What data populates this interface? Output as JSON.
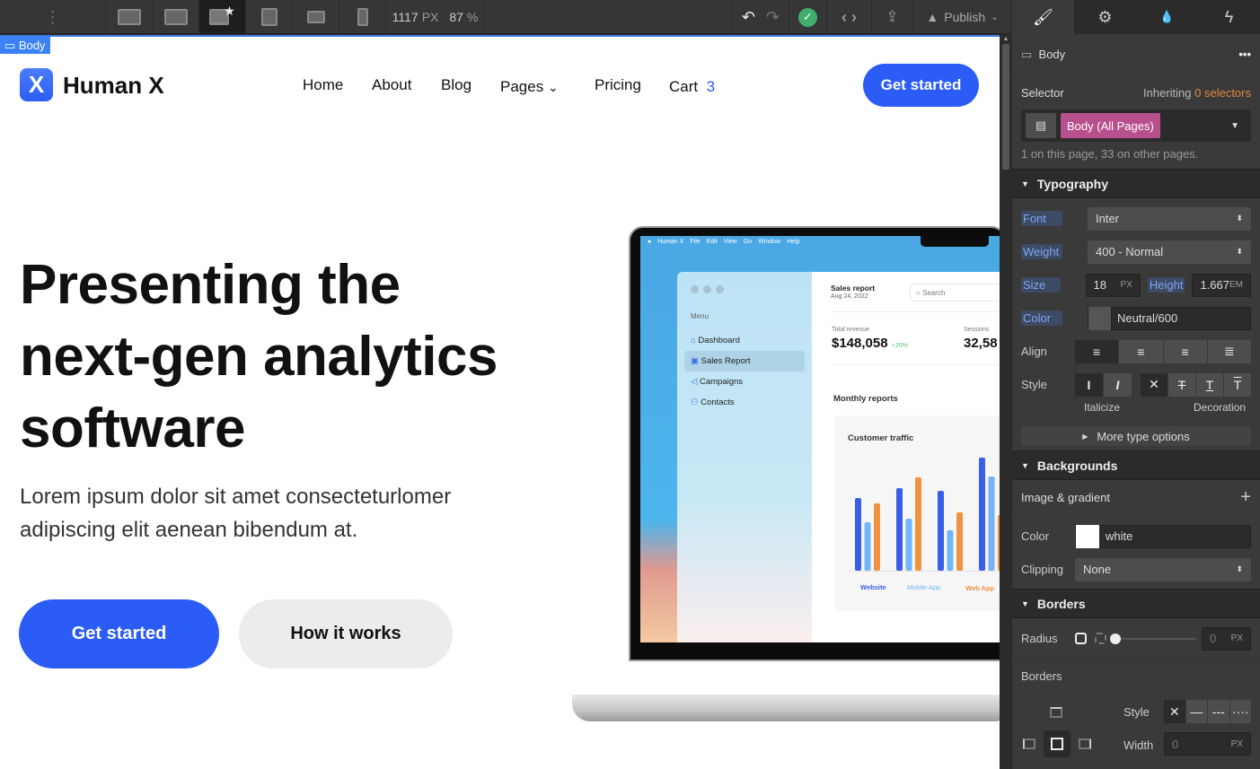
{
  "toolbar": {
    "width_value": "1117",
    "width_unit": "PX",
    "zoom_value": "87",
    "zoom_unit": "%",
    "publish_label": "Publish",
    "devices": [
      "desktop-xl",
      "desktop-l",
      "desktop-base",
      "tablet",
      "mobile-landscape",
      "mobile-portrait"
    ]
  },
  "canvas": {
    "selected_element": "Body"
  },
  "site": {
    "brand": "Human X",
    "logo_letter": "X",
    "nav": [
      "Home",
      "About",
      "Blog",
      "Pages",
      "Pricing"
    ],
    "cart_label": "Cart",
    "cart_count": "3",
    "cta": "Get started",
    "hero": {
      "title_lines": [
        "Presenting the",
        "next-gen analytics",
        "software"
      ],
      "subtitle_lines": [
        "Lorem ipsum dolor sit amet consecteturlomer",
        "adipiscing elit aenean bibendum at."
      ],
      "primary_button": "Get started",
      "secondary_button": "How it works"
    },
    "accent": "#2c5cf6"
  },
  "mockup": {
    "menubar": [
      "Human X",
      "File",
      "Edit",
      "View",
      "Go",
      "Window",
      "Help"
    ],
    "menu_title": "Menu",
    "menu": [
      "Dashboard",
      "Sales Report",
      "Campaigns",
      "Contacts"
    ],
    "report_title": "Sales report",
    "report_date": "Aug 24, 2022",
    "search": "Search",
    "revenue_label": "Total revenue",
    "revenue_value": "$148,058",
    "revenue_change": "+20%",
    "sessions_label": "Sessions",
    "sessions_value": "32,58",
    "monthly": "Monthly reports",
    "chart_title": "Customer traffic",
    "chart": {
      "legend": [
        "Website",
        "Mobile App",
        "Web App"
      ],
      "colors": [
        "#3a5ee8",
        "#72b4f5",
        "#ef9340"
      ],
      "groups": [
        [
          81,
          54,
          75
        ],
        [
          92,
          58,
          104
        ],
        [
          89,
          45,
          65
        ],
        [
          126,
          105,
          62
        ]
      ]
    }
  },
  "panel": {
    "element": "Body",
    "selector_label": "Selector",
    "inheriting": "Inheriting",
    "inherit_count": "0 selectors",
    "selector_chip": "Body (All Pages)",
    "usage": "1 on this page, 33 on other pages.",
    "typography": {
      "title": "Typography",
      "font_label": "Font",
      "font": "Inter",
      "weight_label": "Weight",
      "weight": "400 - Normal",
      "size_label": "Size",
      "size": "18",
      "size_unit": "PX",
      "height_label": "Height",
      "height": "1.667",
      "height_unit": "EM",
      "color_label": "Color",
      "color": "Neutral/600",
      "align_label": "Align",
      "style_label": "Style",
      "italicize": "Italicize",
      "decoration": "Decoration",
      "more": "More type options"
    },
    "backgrounds": {
      "title": "Backgrounds",
      "image_gradient": "Image & gradient",
      "color_label": "Color",
      "color": "white",
      "clipping_label": "Clipping",
      "clipping": "None"
    },
    "borders": {
      "title": "Borders",
      "radius_label": "Radius",
      "radius": "0",
      "radius_unit": "PX",
      "borders_label": "Borders",
      "style_label": "Style",
      "width_label": "Width",
      "width": "0",
      "width_unit": "PX"
    }
  }
}
